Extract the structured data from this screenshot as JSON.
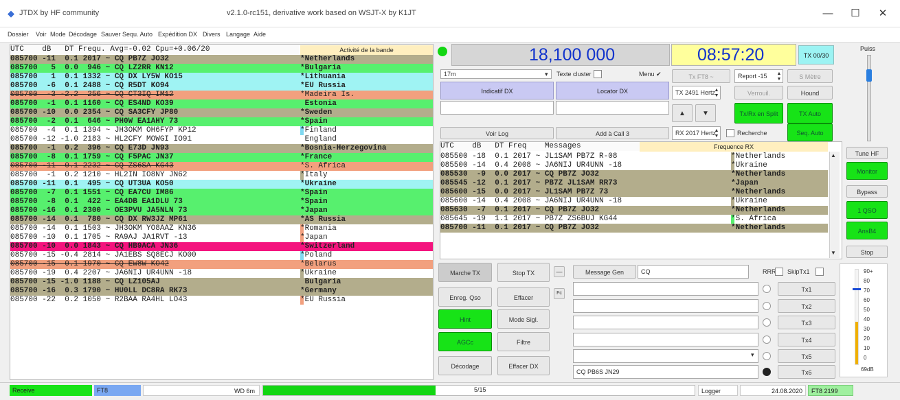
{
  "app": {
    "logo_glyph": "◆",
    "name": "JTDX by HF community",
    "version_title": "v2.1.0-rc151, derivative work based on WSJT-X by K1JT",
    "minimize": "—",
    "maximize": "☐",
    "close": "✕"
  },
  "menu": [
    "Dossier",
    "Voir",
    "Mode",
    "Décodage",
    "Sauver",
    "Sequ. Auto",
    "Expédition DX",
    "Divers",
    "Langage",
    "Aide"
  ],
  "band_activity": {
    "header_left": "UTC    dB   DT Frequ. Avg=-0.02 Cpu=+0.06/20",
    "header_right": "Activité de la bande",
    "rows": [
      {
        "l": "085700 -11  0.1 2017 ~ CQ PB7Z JO32",
        "r": "*Netherlands",
        "bg": "#b3ad8c",
        "bold": true,
        "strike": false,
        "flag": ""
      },
      {
        "l": "085700   5  0.0  946 ~ CQ LZ2RR KN12",
        "r": "*Bulgaria",
        "bg": "#57f06e",
        "bold": true,
        "strike": false,
        "flag": ""
      },
      {
        "l": "085700   1  0.1 1332 ~ CQ DX LY5W KO15",
        "r": "*Lithuania",
        "bg": "#9ff3f3",
        "bold": true,
        "strike": false,
        "flag": ""
      },
      {
        "l": "085700  -6  0.1 2488 ~ CQ R5DT KO94",
        "r": "*EU Russia",
        "bg": "#9ff3f3",
        "bold": true,
        "strike": false,
        "flag": ""
      },
      {
        "l": "085700  -3 -2.2  256 ~ CQ CT3IQ IM12",
        "r": "*Madeira Is.",
        "bg": "#f2a07e",
        "bold": false,
        "strike": true,
        "flag": ""
      },
      {
        "l": "085700  -1  0.1 1160 ~ CQ ES4ND KO39",
        "r": " Estonia",
        "bg": "#57f06e",
        "bold": true,
        "strike": false,
        "flag": ""
      },
      {
        "l": "085700 -10  0.0 2354 ~ CQ SA3CFY JP80",
        "r": "*Sweden",
        "bg": "#b3ad8c",
        "bold": true,
        "strike": false,
        "flag": ""
      },
      {
        "l": "085700  -2  0.1  646 ~ PH0W EA1AHY 73",
        "r": "*Spain",
        "bg": "#57f06e",
        "bold": true,
        "strike": false,
        "flag": ""
      },
      {
        "l": "085700  -4  0.1 1394 ~ JH3OKM OH6FYP KP12",
        "r": "*Finland",
        "bg": "#ffffff",
        "bold": false,
        "strike": false,
        "flag": "#7fd8f0"
      },
      {
        "l": "085700 -12 -1.0 2183 ~ HL2CFY MOWGI IO91",
        "r": " England",
        "bg": "#ffffff",
        "bold": false,
        "strike": false,
        "flag": ""
      },
      {
        "l": "085700  -1  0.2  396 ~ CQ E73D JN93",
        "r": "*Bosnia-Herzegovina",
        "bg": "#b3ad8c",
        "bold": true,
        "strike": false,
        "flag": ""
      },
      {
        "l": "085700  -8  0.1 1759 ~ CQ F5PAC JN37",
        "r": "*France",
        "bg": "#57f06e",
        "bold": true,
        "strike": false,
        "flag": ""
      },
      {
        "l": "085700 -11  0.1 2232 ~ CQ ZS6SA KG43",
        "r": "*S. Africa",
        "bg": "#f2a07e",
        "bold": false,
        "strike": true,
        "flag": ""
      },
      {
        "l": "085700  -1  0.2 1210 ~ HL2IN IO8NY JN62",
        "r": "*Italy",
        "bg": "#ffffff",
        "bold": false,
        "strike": false,
        "flag": "#b3ad8c"
      },
      {
        "l": "085700 -11  0.1  495 ~ CQ UT3UA KO50",
        "r": "*Ukraine",
        "bg": "#9ff3f3",
        "bold": true,
        "strike": false,
        "flag": ""
      },
      {
        "l": "085700  -7  0.1 1551 ~ CQ EA7CU IM86",
        "r": "*Spain",
        "bg": "#57f06e",
        "bold": true,
        "strike": false,
        "flag": ""
      },
      {
        "l": "085700  -8  0.1  422 ~ EA4DB EA1DLU 73",
        "r": "*Spain",
        "bg": "#57f06e",
        "bold": true,
        "strike": false,
        "flag": ""
      },
      {
        "l": "085700 -16  0.1 2300 ~ OE3PVU JA5NLN 73",
        "r": "*Japan",
        "bg": "#57f06e",
        "bold": true,
        "strike": false,
        "flag": ""
      },
      {
        "l": "085700 -14  0.1  780 ~ CQ DX RW3JZ MP61",
        "r": "*AS Russia",
        "bg": "#b3ad8c",
        "bold": true,
        "strike": false,
        "flag": ""
      },
      {
        "l": "085700 -14  0.1 1503 ~ JH3OKM YO8AAZ KN36",
        "r": "*Romania",
        "bg": "#ffffff",
        "bold": false,
        "strike": false,
        "flag": "#f2a07e"
      },
      {
        "l": "085700 -10  0.1 1705 ~ RA9AJ JA1RVT -13",
        "r": "*Japan",
        "bg": "#ffffff",
        "bold": false,
        "strike": false,
        "flag": "#f2a07e"
      },
      {
        "l": "085700 -10  0.0 1843 ~ CQ HB9ACA JN36",
        "r": "*Switzerland",
        "bg": "#f4147e",
        "bold": true,
        "strike": false,
        "flag": ""
      },
      {
        "l": "085700 -15 -0.4 2814 ~ JA1EBS SQ8ECJ KO00",
        "r": "*Poland",
        "bg": "#ffffff",
        "bold": false,
        "strike": false,
        "flag": "#7fd8f0"
      },
      {
        "l": "085700 -15  0.1 1970 ~ CQ EW8W KO42",
        "r": "*Belarus",
        "bg": "#f2a07e",
        "bold": false,
        "strike": true,
        "flag": ""
      },
      {
        "l": "085700 -19  0.4 2207 ~ JA6NIJ UR4UNN -18",
        "r": "*Ukraine",
        "bg": "#ffffff",
        "bold": false,
        "strike": false,
        "flag": "#b3ad8c"
      },
      {
        "l": "085700 -15 -1.0 1188 ~ CQ LZ105AJ",
        "r": " Bulgaria",
        "bg": "#b3ad8c",
        "bold": true,
        "strike": false,
        "flag": ""
      },
      {
        "l": "085700 -16  0.3 1790 ~ HU0LL DC8RA RK73",
        "r": "*Germany",
        "bg": "#b3ad8c",
        "bold": true,
        "strike": false,
        "flag": ""
      },
      {
        "l": "085700 -22  0.2 1050 ~ R2BAA RA4HL LO43",
        "r": "*EU Russia",
        "bg": "#ffffff",
        "bold": false,
        "strike": false,
        "flag": "#f2a07e"
      }
    ]
  },
  "freq_display": "18,100 000",
  "time_display": "08:57:20",
  "tx_mode_badge": "TX 00/30",
  "power_label": "Puiss",
  "band_select": "17m",
  "texte_cluster": "Texte cluster",
  "menu_label": "Menu ✔",
  "dx_call_label": "Indicatif DX",
  "dx_grid_label": "Locator DX",
  "voir_log": "Voir Log",
  "add_call": "Add à Call 3",
  "tx_ft8": "Tx FT8 ~",
  "report": "Report -15",
  "s_meter": "S Mètre",
  "tx_hertz": "TX 2491 Hertz",
  "verrou": "Verrouil.",
  "hound": "Hound",
  "tx_rx_split": "Tx/Rx en Split",
  "tx_auto": "TX Auto",
  "rx_hertz": "RX 2017 Hertz",
  "recherche": "Recherche",
  "sequ_auto": "Seq. Auto",
  "rx_frequency": {
    "header_left": "UTC    dB   DT Freq    Messages",
    "header_right": "Frequence RX",
    "rows": [
      {
        "l": "085500 -18  0.1 2017 ~ JL1SAM PB7Z R-08",
        "r": "*Netherlands",
        "bg": "#ffffff",
        "flag": "#b3ad8c",
        "bold": false
      },
      {
        "l": "085500 -14  0.4 2008 ~ JA6NIJ UR4UNN -18",
        "r": "*Ukraine",
        "bg": "#ffffff",
        "flag": "#b3ad8c",
        "bold": false
      },
      {
        "l": "085530  -9  0.0 2017 ~ CQ PB7Z JO32",
        "r": "*Netherlands",
        "bg": "#b3ad8c",
        "flag": "",
        "bold": true
      },
      {
        "l": "085545 -12  0.1 2017 ~ PB7Z JL1SAM RR73",
        "r": "*Japan",
        "bg": "#b3ad8c",
        "flag": "",
        "bold": true
      },
      {
        "l": "085600 -15  0.0 2017 ~ JL1SAM PB7Z 73",
        "r": "*Netherlands",
        "bg": "#b3ad8c",
        "flag": "",
        "bold": true
      },
      {
        "l": "085600 -14  0.4 2008 ~ JA6NIJ UR4UNN -18",
        "r": "*Ukraine",
        "bg": "#ffffff",
        "flag": "#b3ad8c",
        "bold": false
      },
      {
        "l": "085630  -7  0.1 2017 ~ CQ PB7Z JO32",
        "r": "*Netherlands",
        "bg": "#b3ad8c",
        "flag": "",
        "bold": true
      },
      {
        "l": "085645 -19  1.1 2017 ~ PB7Z ZS6BUJ KG44",
        "r": "*S. Africa",
        "bg": "#ffffff",
        "flag": "#57f06e",
        "bold": false
      },
      {
        "l": "085700 -11  0.1 2017 ~ CQ PB7Z JO32",
        "r": "*Netherlands",
        "bg": "#b3ad8c",
        "flag": "",
        "bold": true
      }
    ]
  },
  "side_buttons": [
    "Tune HF",
    "Monitor",
    "Bypass",
    "1 QSO",
    "AnsB4",
    "Stop"
  ],
  "marche_tx": "Marche TX",
  "stop_tx": "Stop TX",
  "enreg_qso": "Enreg. Qso",
  "effacer": "Effacer",
  "mode_sigl": "Mode Sigl.",
  "filtre": "Filtre",
  "decodage": "Décodage",
  "effacer_dx": "Effacer DX",
  "hint": "Hint",
  "agcc": "AGCc",
  "message_gen": "Message Gen",
  "gen_value": "CQ",
  "rrr": "RRR",
  "skip_tx1": "SkipTx1",
  "tx_buttons": [
    "Tx1",
    "Tx2",
    "Tx3",
    "Tx4",
    "Tx5",
    "Tx6"
  ],
  "tx6_value": "CQ PB6S JN29",
  "arrow_btns": [
    "—",
    "Fc"
  ],
  "level_scale": [
    "90+",
    "80",
    "70",
    "60",
    "50",
    "40",
    "30",
    "20",
    "10",
    "0"
  ],
  "level_unit": "69dB",
  "level_fraction": 0.45,
  "status": {
    "receive": "Receive",
    "mode": "FT8",
    "wd": "WD 6m",
    "progress": "5/15",
    "progress_fraction": 0.4,
    "logger": "Logger",
    "date": "24.08.2020",
    "ft8_count": "FT8 2199"
  },
  "colors": {
    "green": "#57f06e",
    "khaki": "#b3ad8c",
    "cyan": "#9ff3f3",
    "salmon": "#f2a07e",
    "magenta": "#f4147e",
    "button_green": "#17e317"
  }
}
